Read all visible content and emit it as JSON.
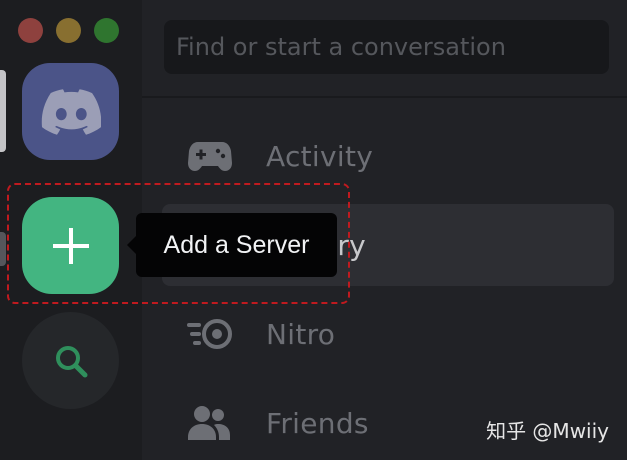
{
  "window": {
    "controls": [
      "close",
      "minimize",
      "zoom"
    ]
  },
  "server_rail": {
    "home_icon": "discord-logo-icon",
    "add_server_icon": "plus-icon",
    "explore_icon": "search-icon"
  },
  "tooltip": {
    "text": "Add a Server"
  },
  "search": {
    "placeholder": "Find or start a conversation"
  },
  "nav": {
    "items": [
      {
        "label": "Activity",
        "icon": "gamepad-icon"
      },
      {
        "label": "Library",
        "icon": "library-icon"
      },
      {
        "label": "Nitro",
        "icon": "nitro-icon"
      },
      {
        "label": "Friends",
        "icon": "friends-icon"
      }
    ]
  },
  "watermark": {
    "text": "知乎 @Mwiiy"
  },
  "colors": {
    "add_button": "#43b581",
    "home_button": "#4b5488",
    "highlight_dash": "#c01a1f",
    "tooltip_bg": "#040405"
  }
}
